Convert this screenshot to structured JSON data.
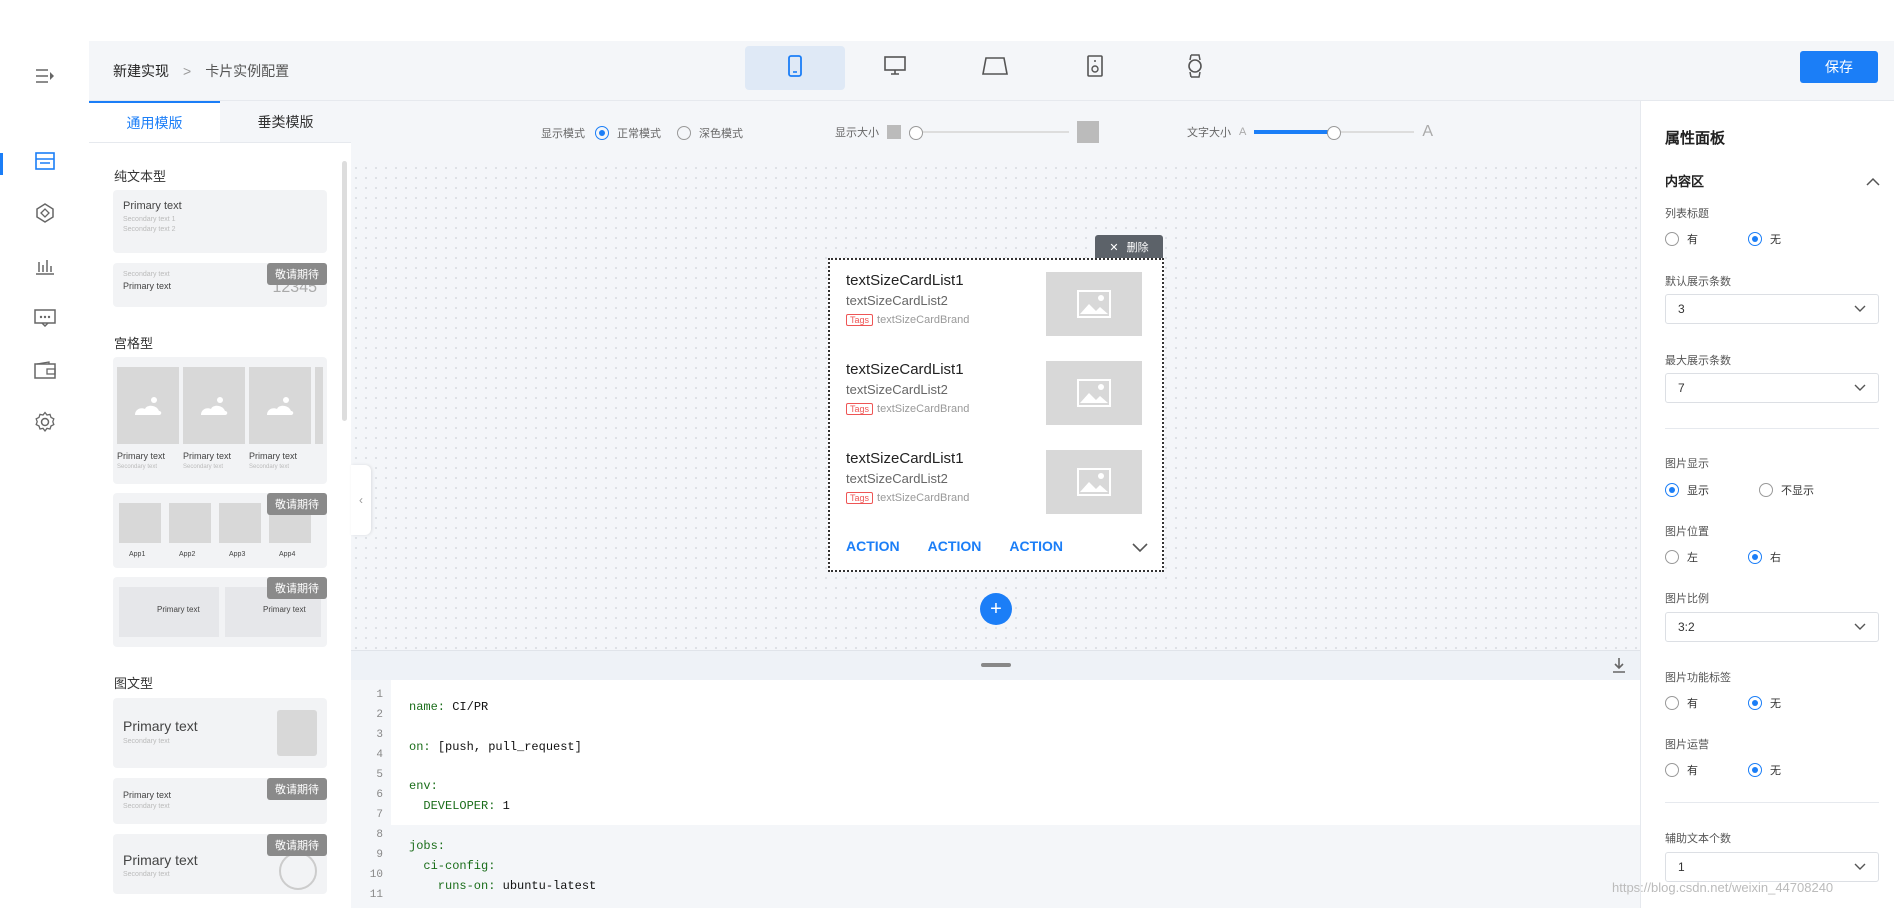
{
  "breadcrumb": {
    "first": "新建实现",
    "sep": ">",
    "second": "卡片实例配置"
  },
  "devices": [
    "phone-icon",
    "monitor-icon",
    "tablet-icon",
    "speaker-icon",
    "watch-icon"
  ],
  "save_label": "保存",
  "template_panel": {
    "tabs": [
      "通用模版",
      "垂类模版"
    ],
    "sections": {
      "plain": "纯文本型",
      "grid": "宫格型",
      "image_text": "图文型"
    },
    "primary": "Primary text",
    "secondary": "Secondary text",
    "secondary1": "Secondary text 1",
    "secondary2": "Secondary text 2",
    "number": "12345",
    "badge": "敬请期待",
    "apps": [
      "App1",
      "App2",
      "App3",
      "App4"
    ]
  },
  "toolbar": {
    "display_mode": "显示模式",
    "normal": "正常模式",
    "dark": "深色模式",
    "display_size": "显示大小",
    "text_size": "文字大小",
    "a_small": "A",
    "a_big": "A",
    "text_size_level": 0.5
  },
  "card": {
    "delete": "删除",
    "items": [
      {
        "title": "textSizeCardList1",
        "sub": "textSizeCardList2",
        "tag": "Tags",
        "brand": "textSizeCardBrand"
      },
      {
        "title": "textSizeCardList1",
        "sub": "textSizeCardList2",
        "tag": "Tags",
        "brand": "textSizeCardBrand"
      },
      {
        "title": "textSizeCardList1",
        "sub": "textSizeCardList2",
        "tag": "Tags",
        "brand": "textSizeCardBrand"
      }
    ],
    "actions": [
      "ACTION",
      "ACTION",
      "ACTION"
    ]
  },
  "code": {
    "line_numbers": [
      "1",
      "2",
      "3",
      "4",
      "5",
      "6",
      "7",
      "8",
      "9",
      "10",
      "11"
    ],
    "lines": [
      {
        "key": "name:",
        "val": "CI/PR"
      },
      {
        "key": "on:",
        "val": "[push, pull_request]"
      },
      {
        "key": "env:",
        "val": ""
      },
      {
        "key": "  DEVELOPER:",
        "val": "1"
      },
      {
        "key": "jobs:",
        "val": ""
      },
      {
        "key": "  ci-config:",
        "val": ""
      },
      {
        "key": "    runs-on:",
        "val": "ubuntu-latest"
      }
    ]
  },
  "props": {
    "title": "属性面板",
    "content_area": "内容区",
    "list_title": "列表标题",
    "yes": "有",
    "no": "无",
    "default_count_label": "默认展示条数",
    "default_count": "3",
    "max_count_label": "最大展示条数",
    "max_count": "7",
    "img_display": "图片显示",
    "show": "显示",
    "hide": "不显示",
    "img_pos": "图片位置",
    "left": "左",
    "right": "右",
    "img_ratio": "图片比例",
    "ratio": "3:2",
    "img_tag": "图片功能标签",
    "img_ops": "图片运营",
    "aux_count_label": "辅助文本个数",
    "aux_count": "1"
  },
  "watermark": "https://blog.csdn.net/weixin_44708240"
}
